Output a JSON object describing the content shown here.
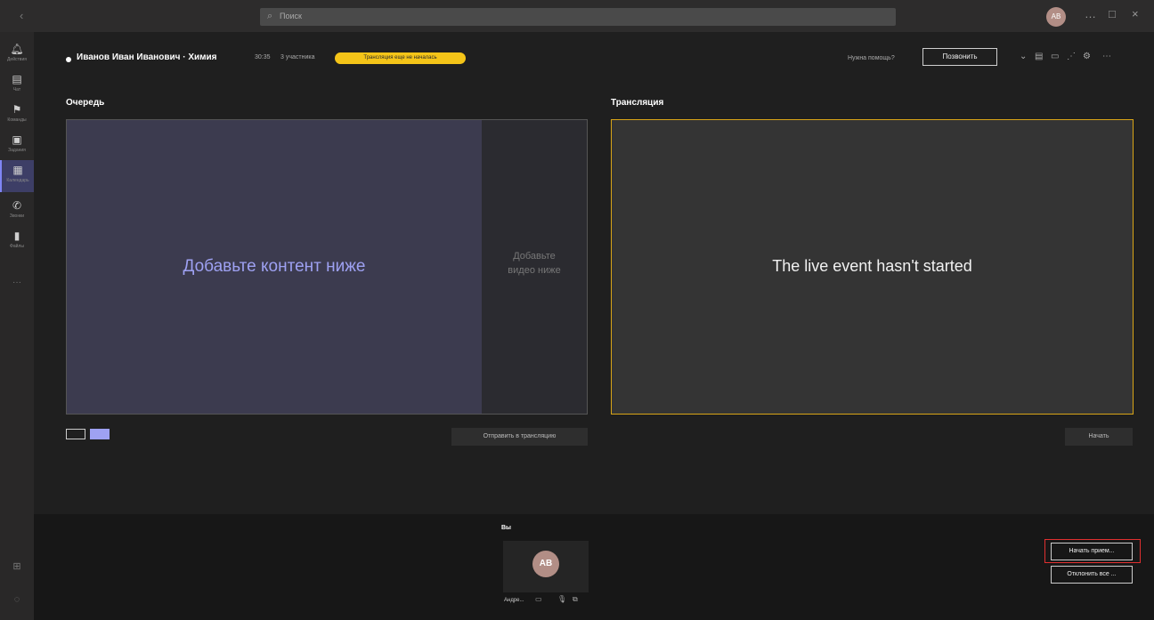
{
  "titlebar": {
    "back_icon": "arrow-left-icon",
    "search_placeholder": "Поиск",
    "avatar_initials": "АВ",
    "window_controls": [
      "…",
      "□",
      "×"
    ]
  },
  "rail": {
    "items": [
      {
        "icon": "bell-icon",
        "label": "Действия"
      },
      {
        "icon": "chat-icon",
        "label": "Чат"
      },
      {
        "icon": "teams-icon",
        "label": "Команды"
      },
      {
        "icon": "assignments-icon",
        "label": "Задания"
      },
      {
        "icon": "calendar-icon",
        "label": "Календарь",
        "active": true
      },
      {
        "icon": "phone-icon",
        "label": "Звонки"
      },
      {
        "icon": "files-icon",
        "label": "Файлы"
      }
    ],
    "more": "···"
  },
  "header": {
    "title": "Иванов Иван Иванович · Химия",
    "time": "30:35",
    "participants": "3 участника",
    "status": "Трансляция еще не началась",
    "help_link": "Нужна помощь?",
    "call_button": "Позвонить"
  },
  "queue": {
    "title": "Очередь",
    "main_placeholder": "Добавьте контент ниже",
    "side_placeholder_line1": "Добавьте",
    "side_placeholder_line2": "видео ниже",
    "send_button": "Отправить в трансляцию"
  },
  "broadcast": {
    "title": "Трансляция",
    "status_text": "The live event hasn't started",
    "start_button": "Начать"
  },
  "bottom": {
    "you_label": "Вы",
    "you_avatar": "АВ",
    "you_name": "Андре...",
    "request_button": "Начать прием...",
    "reject_button": "Отклонить все ..."
  },
  "colors": {
    "accent": "#9ea1f2",
    "live_border": "#d9a517",
    "status_badge": "#f4c418",
    "annotation": "#e03030"
  }
}
